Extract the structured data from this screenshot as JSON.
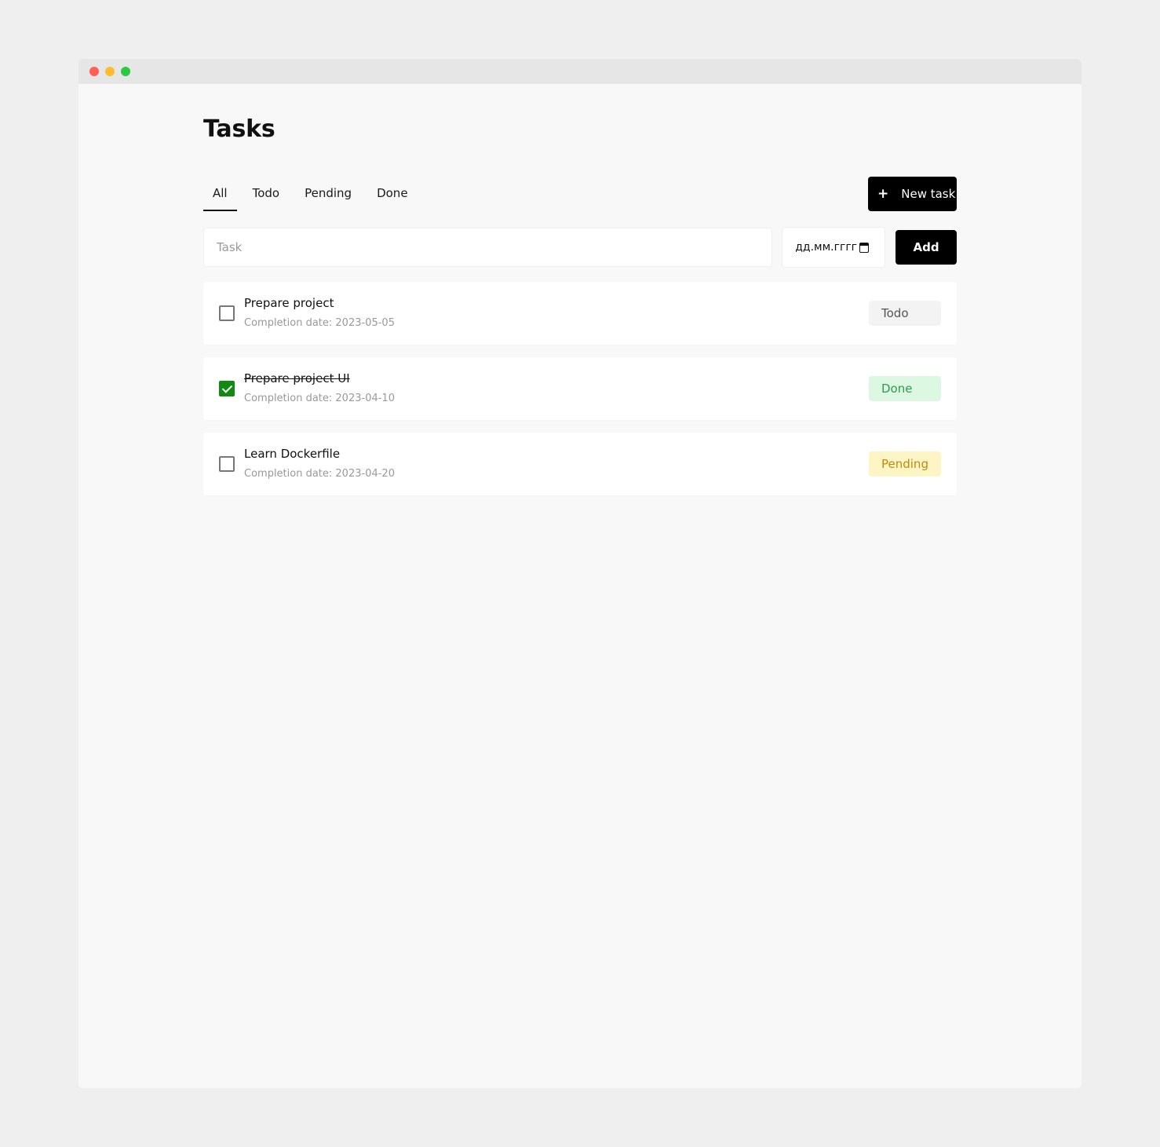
{
  "window": {
    "traffic_lights": [
      {
        "name": "close",
        "color": "#ff5f57"
      },
      {
        "name": "minimize",
        "color": "#febc2e"
      },
      {
        "name": "maximize",
        "color": "#28c840"
      }
    ]
  },
  "header": {
    "title": "Tasks"
  },
  "tabs": [
    {
      "label": "All",
      "active": true
    },
    {
      "label": "Todo",
      "active": false
    },
    {
      "label": "Pending",
      "active": false
    },
    {
      "label": "Done",
      "active": false
    }
  ],
  "new_task_button": {
    "icon": "plus-icon",
    "label": "New task"
  },
  "form": {
    "task_placeholder": "Task",
    "date_placeholder": "дд.мм.гггг",
    "date_icon": "calendar-icon",
    "add_label": "Add"
  },
  "tasks": [
    {
      "name": "Prepare project",
      "completion": "Completion date: 2023-05-05",
      "checked": false,
      "status": "Todo",
      "badge_bg": "#f3f3f3",
      "badge_fg": "#555555"
    },
    {
      "name": "Prepare project UI",
      "completion": "Completion date: 2023-04-10",
      "checked": true,
      "status": "Done",
      "badge_bg": "#dcf8e3",
      "badge_fg": "#2f9a4f"
    },
    {
      "name": "Learn Dockerfile",
      "completion": "Completion date: 2023-04-20",
      "checked": false,
      "status": "Pending",
      "badge_bg": "#fdf5c3",
      "badge_fg": "#c08a10"
    }
  ],
  "colors": {
    "accent": "#000000",
    "checked": "#118a11"
  }
}
